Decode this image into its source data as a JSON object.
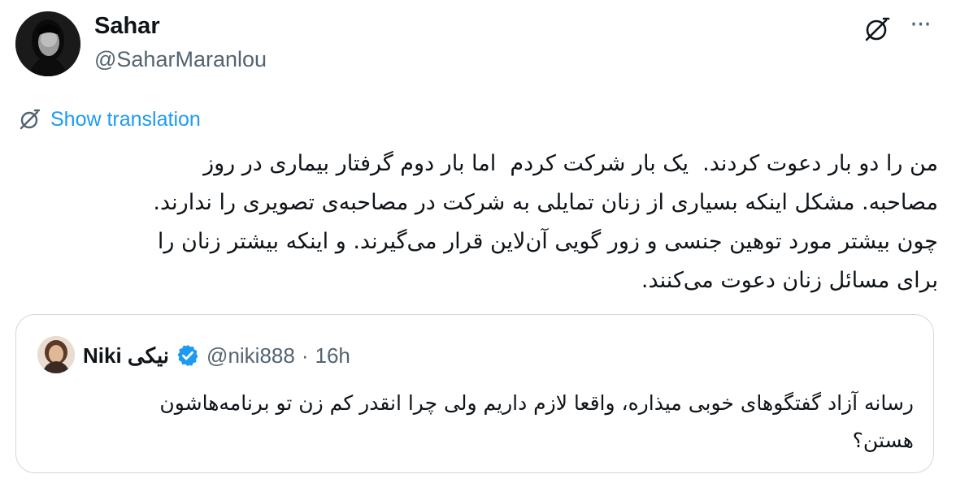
{
  "author": {
    "display_name": "Sahar",
    "handle": "@SaharMaranlou"
  },
  "actions": {
    "grok_icon": "slashed-circle-icon",
    "more_label": "···"
  },
  "translation": {
    "label": "Show translation"
  },
  "tweet": {
    "lines": [
      "من را دو بار دعوت کردند.  یک بار شرکت کردم  اما بار دوم گرفتار بیماری در روز",
      "مصاحبه. مشکل اینکه بسیاری از زنان تمایلی به شرکت در مصاحبه‌ی تصویری را ندارند.",
      "چون بیشتر مورد توهین جنسی و زور گویی آن‌لاین قرار می‌گیرند. و اینکه بیشتر زنان را",
      "برای مسائل زنان دعوت می‌کنند."
    ]
  },
  "quote": {
    "name": "Niki نیکی",
    "handle": "@niki888",
    "separator": "·",
    "time": "16h",
    "lines": [
      "رسانه آزاد گفتگوهای خوبی میذاره، واقعا لازم داریم ولی چرا انقدر کم زن تو برنامه‌هاشون",
      "هستن؟"
    ]
  },
  "colors": {
    "link": "#1d9bf0",
    "secondary": "#536471",
    "border": "#cfd9de",
    "verified": "#1d9bf0"
  }
}
